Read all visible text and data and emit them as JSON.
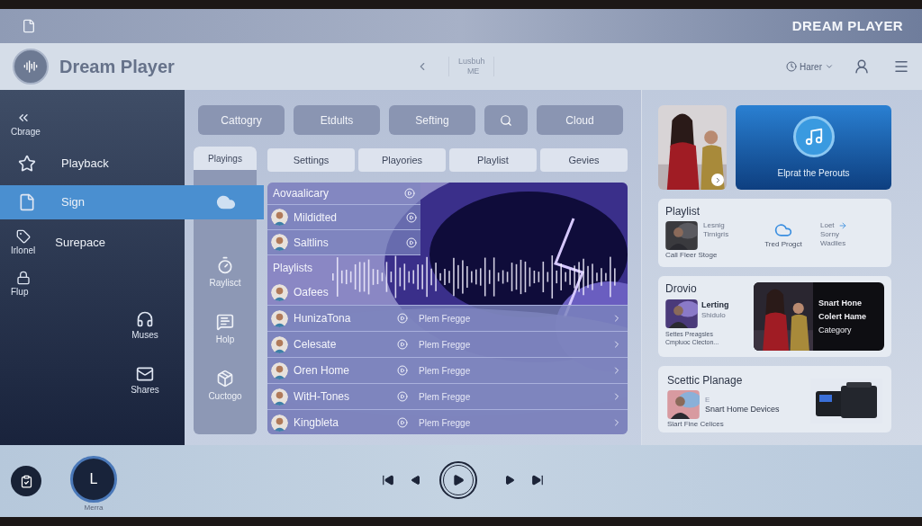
{
  "topbar": {
    "title": "DREAM PLAYER"
  },
  "header": {
    "title": "Dream Player",
    "center_lines": [
      "Lusbuh",
      "ME"
    ],
    "user_menu": "Harer"
  },
  "sidebar": {
    "items": [
      {
        "kind": "stacked",
        "label": "Cbrage",
        "selected": false
      },
      {
        "kind": "inline",
        "label": "Playback",
        "selected": false
      },
      {
        "kind": "inline",
        "label": "Sign",
        "selected": true
      },
      {
        "kind": "split",
        "caption": "Irlonel",
        "label": "Surepace",
        "selected": false
      },
      {
        "kind": "stacked",
        "label": "Flup",
        "selected": false
      }
    ],
    "shortcuts": [
      "Muses",
      "Shares"
    ]
  },
  "side_nav": {
    "tab": "Playings",
    "items": [
      "Raylisct",
      "Holp",
      "Cuctogo"
    ]
  },
  "toolbar": [
    {
      "kind": "text",
      "label": "Cattogry"
    },
    {
      "kind": "text",
      "label": "Etdults"
    },
    {
      "kind": "text",
      "label": "Sefting"
    },
    {
      "kind": "search"
    },
    {
      "kind": "text",
      "label": "Cloud"
    }
  ],
  "tabs": [
    "Settings",
    "Playories",
    "Playlist",
    "Gevies"
  ],
  "list": {
    "rows": [
      {
        "kind": "header",
        "title": "Aovaalicary"
      },
      {
        "kind": "item",
        "title": "Mildidted"
      },
      {
        "kind": "item",
        "title": "Saltlins"
      },
      {
        "kind": "section",
        "title": "Playlists"
      },
      {
        "kind": "artist",
        "title": "Oafees"
      },
      {
        "kind": "track",
        "title": "HunizaTona",
        "info": "Plem Fregge"
      },
      {
        "kind": "track",
        "title": "Celesate",
        "info": "Plem Fregge"
      },
      {
        "kind": "track",
        "title": "Oren Home",
        "info": "Plem Fregge"
      },
      {
        "kind": "track",
        "title": "WitH-Tones",
        "info": "Plem Fregge"
      },
      {
        "kind": "track",
        "title": "Kingbleta",
        "info": "Plem Fregge"
      }
    ]
  },
  "right": {
    "feature": {
      "title": "Elprat the Perouts"
    },
    "playlist": {
      "title": "Playlist",
      "thumb_lines": [
        "Lesnig",
        "Tirnigris"
      ],
      "caption": "Call Fleer Stoge",
      "cloud": "Tred Progct",
      "link_lines": [
        "Loet",
        "Sorny",
        "Wadlies"
      ]
    },
    "drovio": {
      "title": "Drovio",
      "bold": "Lerting",
      "sub": "Shidulo",
      "lines": [
        "Settes Preagsles",
        "Cmpluoc Clecton..."
      ],
      "promo": [
        "Snart Hone",
        "Colert Hame",
        "Category"
      ]
    },
    "planage": {
      "title": "Scettic Planage",
      "small": "E",
      "device": "Snart Home Devices",
      "caption": "Slart Fine Celices"
    }
  },
  "player": {
    "avatar": "L",
    "name": "Merra"
  }
}
